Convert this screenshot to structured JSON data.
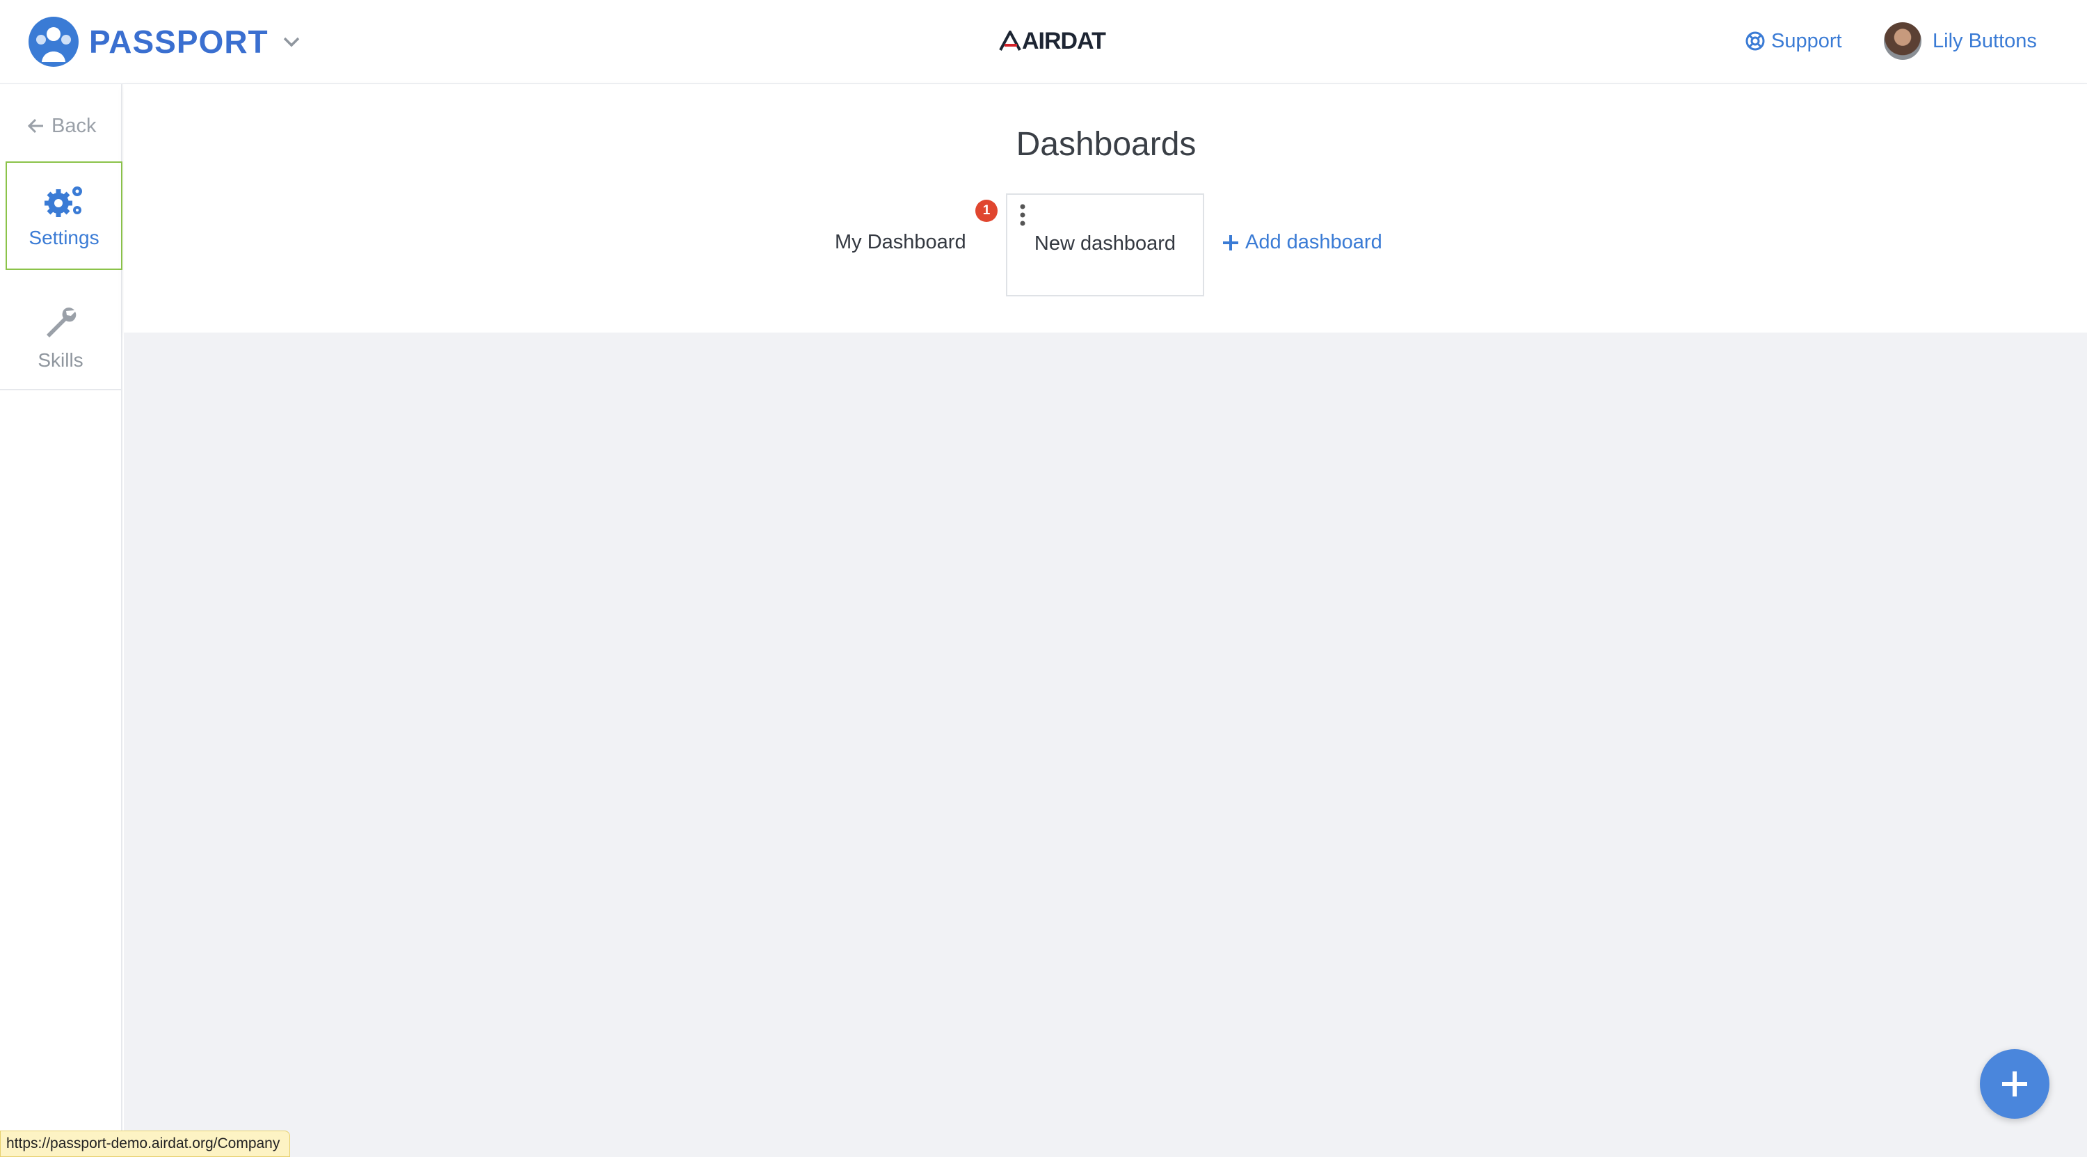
{
  "app": {
    "name": "PASSPORT",
    "center_logo": "AIRDAT"
  },
  "header": {
    "support_label": "Support",
    "user_name": "Lily Buttons"
  },
  "sidebar": {
    "back_label": "Back",
    "items": [
      {
        "label": "Settings",
        "icon": "gears-icon",
        "active": true
      },
      {
        "label": "Skills",
        "icon": "wrench-icon",
        "active": false
      }
    ]
  },
  "main": {
    "title": "Dashboards",
    "tabs": [
      {
        "label": "My Dashboard",
        "badge": "1"
      },
      {
        "label": "New dashboard",
        "selected": true
      }
    ],
    "add_label": "Add dashboard"
  },
  "status_bar": {
    "url": "https://passport-demo.airdat.org/Company"
  },
  "colors": {
    "accent": "#3a7bd5",
    "brand": "#3a6fd0",
    "badge": "#e0462f",
    "active_border": "#8bc34a",
    "fab": "#4a86dc"
  }
}
